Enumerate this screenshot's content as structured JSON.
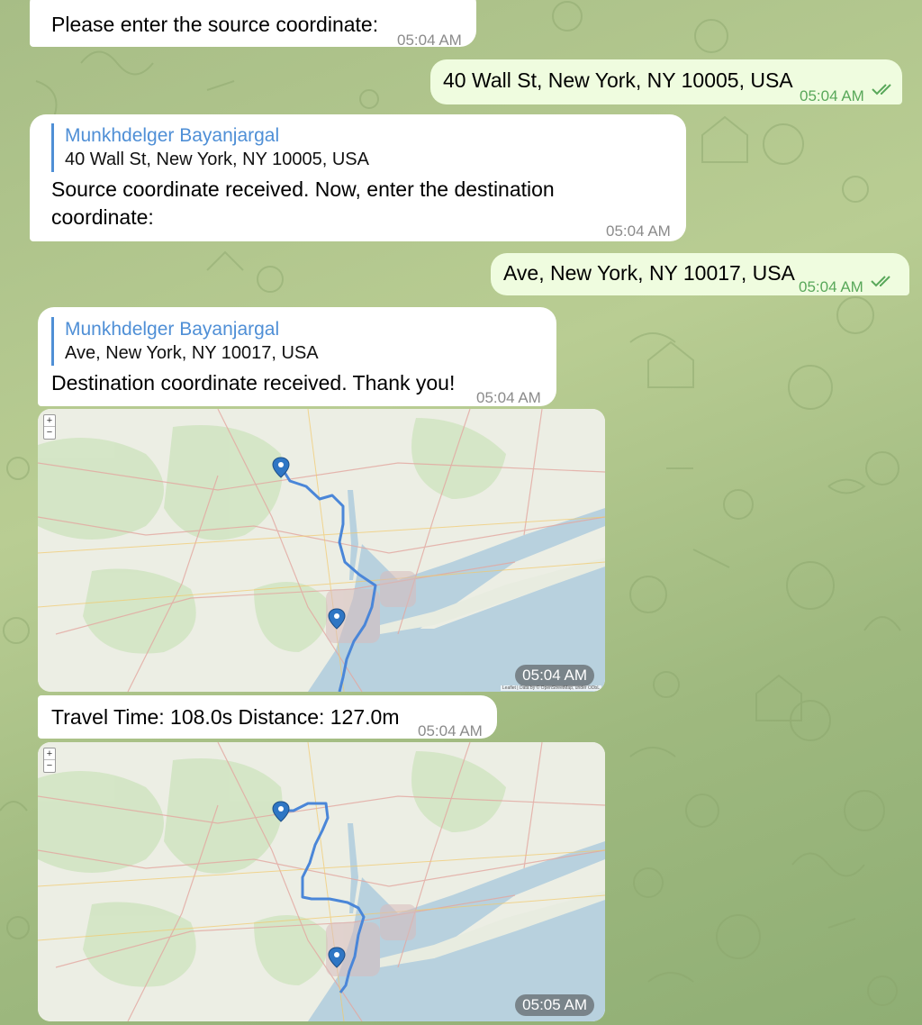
{
  "theme": {
    "incoming_bg": "#ffffff",
    "outgoing_bg": "#effcdf",
    "reply_accent": "#4f8fd6",
    "outgoing_time_color": "#59a85a",
    "water_color": "#b8d1de",
    "route_color": "#4a86d8"
  },
  "messages": {
    "m1": {
      "text": "Please enter the source coordinate:",
      "time": "05:04 AM"
    },
    "m2": {
      "text": "40 Wall St, New York, NY 10005, USA",
      "time": "05:04 AM",
      "status_icon": "double-check-icon"
    },
    "m3": {
      "reply_name": "Munkhdelger Bayanjargal",
      "reply_text": "40 Wall St, New York, NY 10005, USA",
      "text": "Source coordinate received. Now, enter the destination coordinate:",
      "time": "05:04 AM"
    },
    "m4": {
      "text": "Ave, New York, NY 10017, USA",
      "time": "05:04 AM",
      "status_icon": "double-check-icon"
    },
    "m5": {
      "reply_name": "Munkhdelger Bayanjargal",
      "reply_text": "Ave, New York, NY 10017, USA",
      "text": "Destination coordinate received. Thank you!",
      "time": "05:04 AM"
    },
    "map1": {
      "time": "05:04 AM",
      "zoom_in": "+",
      "zoom_out": "−",
      "attribution": "Leaflet | Data by © OpenStreetMap, under ODbL"
    },
    "m6": {
      "text": "Travel Time: 108.0s Distance: 127.0m",
      "time": "05:04 AM"
    },
    "map2": {
      "time": "05:05 AM",
      "zoom_in": "+",
      "zoom_out": "−"
    }
  }
}
